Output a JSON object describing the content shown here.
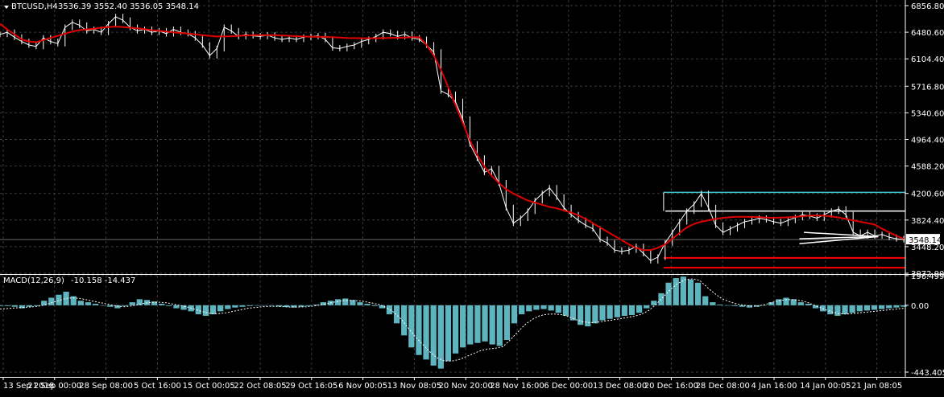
{
  "header": {
    "symbol": "BTCUSD,H4",
    "ohlc": "3536.39 3552.40 3536.05 3548.14"
  },
  "macd": {
    "label": "MACD(12,26,9)",
    "values": "-10.158 -14.437",
    "y_ticks": [
      "196.499",
      "0.00",
      "-443.405"
    ]
  },
  "colors": {
    "background": "#000000",
    "grid": "#3a3a3a",
    "price": "#ffffff",
    "ma": "#e00000",
    "macd_hist": "#5fb5bf",
    "signal": "#ffffff",
    "cyan_level": "#3fc3cf",
    "white_level": "#ffffff",
    "red_level": "#ff0000"
  },
  "chart_data": [
    {
      "type": "line",
      "ylim": [
        3072,
        6856.8
      ],
      "y_ticks": [
        6856.8,
        6480.6,
        6104.4,
        5716.8,
        5340.6,
        4964.4,
        4588.2,
        4200.6,
        3824.4,
        3448.2,
        3072.0
      ],
      "y_tick_labels": [
        "6856.80",
        "6480.60",
        "6104.40",
        "5716.80",
        "5340.60",
        "4964.40",
        "4588.20",
        "4200.60",
        "3824.40",
        "3448.20",
        "3072.00"
      ],
      "x_labels": [
        "13 Sep 2018",
        "21 Sep 00:00",
        "28 Sep 08:00",
        "5 Oct 16:00",
        "15 Oct 00:05",
        "22 Oct 08:05",
        "29 Oct 16:05",
        "6 Nov 00:05",
        "13 Nov 08:05",
        "20 Nov 20:00",
        "28 Nov 16:00",
        "6 Dec 00:00",
        "13 Dec 08:00",
        "20 Dec 16:00",
        "28 Dec 08:00",
        "4 Jan 16:00",
        "14 Jan 00:05",
        "21 Jan 08:05"
      ],
      "current_price": 3548.14,
      "current_price_label": "3548.14",
      "series": [
        {
          "role": "price",
          "values": [
            6450,
            6480,
            6410,
            6350,
            6300,
            6280,
            6400,
            6350,
            6320,
            6550,
            6620,
            6580,
            6500,
            6520,
            6480,
            6600,
            6700,
            6650,
            6550,
            6500,
            6520,
            6480,
            6500,
            6460,
            6520,
            6480,
            6460,
            6400,
            6300,
            6150,
            6250,
            6550,
            6500,
            6420,
            6450,
            6430,
            6420,
            6440,
            6400,
            6380,
            6400,
            6380,
            6410,
            6420,
            6430,
            6380,
            6260,
            6250,
            6280,
            6300,
            6350,
            6380,
            6420,
            6480,
            6460,
            6420,
            6450,
            6400,
            6380,
            6300,
            6200,
            5650,
            5600,
            5500,
            5250,
            4900,
            4700,
            4500,
            4550,
            4350,
            4000,
            3780,
            3850,
            3950,
            4100,
            4200,
            4280,
            4150,
            4000,
            3900,
            3820,
            3750,
            3700,
            3550,
            3500,
            3400,
            3380,
            3400,
            3450,
            3350,
            3250,
            3300,
            3500,
            3650,
            3800,
            3950,
            4050,
            4200,
            4000,
            3750,
            3650,
            3700,
            3750,
            3800,
            3820,
            3850,
            3830,
            3800,
            3780,
            3820,
            3860,
            3900,
            3880,
            3850,
            3900,
            3950,
            3980,
            3900,
            3650,
            3600,
            3650,
            3600,
            3620,
            3580,
            3560,
            3548
          ]
        },
        {
          "role": "moving-average",
          "values": [
            6600,
            6520,
            6450,
            6380,
            6350,
            6340,
            6370,
            6400,
            6430,
            6460,
            6490,
            6510,
            6520,
            6530,
            6545,
            6555,
            6560,
            6555,
            6545,
            6535,
            6525,
            6510,
            6500,
            6490,
            6480,
            6470,
            6460,
            6450,
            6440,
            6430,
            6420,
            6420,
            6425,
            6430,
            6435,
            6438,
            6440,
            6440,
            6438,
            6435,
            6430,
            6425,
            6420,
            6418,
            6416,
            6414,
            6410,
            6405,
            6400,
            6398,
            6396,
            6395,
            6396,
            6398,
            6400,
            6402,
            6405,
            6410,
            6410,
            6300,
            6150,
            5950,
            5700,
            5450,
            5200,
            4950,
            4750,
            4580,
            4450,
            4350,
            4260,
            4200,
            4150,
            4100,
            4070,
            4040,
            4010,
            3990,
            3960,
            3930,
            3890,
            3840,
            3780,
            3720,
            3660,
            3600,
            3540,
            3480,
            3430,
            3400,
            3400,
            3430,
            3480,
            3560,
            3640,
            3720,
            3770,
            3800,
            3820,
            3840,
            3855,
            3865,
            3870,
            3870,
            3868,
            3866,
            3860,
            3855,
            3858,
            3862,
            3870,
            3878,
            3886,
            3890,
            3885,
            3876,
            3860,
            3840,
            3820,
            3800,
            3780,
            3760,
            3700,
            3650,
            3600,
            3560
          ]
        }
      ],
      "horizontal_levels": [
        {
          "value": 4216,
          "from": 0.733,
          "color": "cyan"
        },
        {
          "value": 3952,
          "from": 0.735,
          "color": "white"
        },
        {
          "value": 3290,
          "from": 0.733,
          "color": "red"
        },
        {
          "value": 3150,
          "from": 0.733,
          "color": "red"
        }
      ],
      "triangle": [
        {
          "from": [
            0.883,
            3560
          ],
          "to": [
            0.97,
            3590
          ]
        },
        {
          "from": [
            0.883,
            3490
          ],
          "to": [
            0.97,
            3590
          ]
        },
        {
          "from": [
            0.888,
            3650
          ],
          "to": [
            0.97,
            3590
          ]
        }
      ]
    },
    {
      "type": "bar",
      "ylim": [
        -443.405,
        196.499
      ],
      "series": [
        {
          "role": "histogram",
          "values": [
            -5,
            -5,
            -10,
            -20,
            -10,
            -5,
            30,
            50,
            70,
            90,
            60,
            30,
            20,
            10,
            0,
            -10,
            -20,
            -5,
            20,
            40,
            35,
            25,
            10,
            -5,
            -20,
            -30,
            -40,
            -60,
            -70,
            -60,
            -40,
            -25,
            -15,
            -10,
            -5,
            -2,
            0,
            -3,
            -8,
            -12,
            -15,
            -10,
            -5,
            5,
            20,
            30,
            40,
            45,
            35,
            20,
            10,
            -5,
            -20,
            -60,
            -120,
            -200,
            -280,
            -330,
            -360,
            -400,
            -420,
            -370,
            -320,
            -280,
            -260,
            -250,
            -240,
            -260,
            -270,
            -230,
            -120,
            -60,
            -40,
            -30,
            -25,
            -35,
            -50,
            -70,
            -100,
            -130,
            -140,
            -120,
            -100,
            -90,
            -80,
            -70,
            -65,
            -50,
            -20,
            30,
            80,
            150,
            180,
            190,
            170,
            150,
            60,
            20,
            5,
            0,
            -5,
            -10,
            -15,
            -10,
            0,
            20,
            40,
            50,
            40,
            20,
            10,
            -20,
            -40,
            -60,
            -70,
            -60,
            -50,
            -40,
            -35,
            -30,
            -25,
            -20,
            -15,
            -10
          ]
        },
        {
          "role": "signal",
          "values": [
            -25,
            -22,
            -18,
            -15,
            -12,
            -8,
            0,
            15,
            30,
            45,
            50,
            45,
            35,
            25,
            15,
            5,
            -5,
            -10,
            -5,
            5,
            15,
            20,
            20,
            15,
            5,
            -5,
            -15,
            -30,
            -45,
            -55,
            -55,
            -50,
            -40,
            -30,
            -20,
            -15,
            -10,
            -8,
            -8,
            -10,
            -12,
            -12,
            -10,
            -5,
            3,
            12,
            22,
            30,
            33,
            30,
            25,
            15,
            5,
            -15,
            -45,
            -90,
            -150,
            -210,
            -260,
            -310,
            -350,
            -370,
            -370,
            -360,
            -340,
            -320,
            -300,
            -290,
            -285,
            -275,
            -230,
            -180,
            -130,
            -95,
            -70,
            -60,
            -58,
            -62,
            -75,
            -95,
            -110,
            -115,
            -112,
            -105,
            -98,
            -90,
            -82,
            -73,
            -60,
            -35,
            5,
            55,
            105,
            145,
            170,
            175,
            165,
            120,
            80,
            45,
            25,
            10,
            0,
            -5,
            -5,
            5,
            20,
            32,
            38,
            36,
            30,
            15,
            -5,
            -25,
            -42,
            -55,
            -58,
            -55,
            -50,
            -45,
            -40,
            -35,
            -30,
            -25,
            -20
          ]
        }
      ]
    }
  ]
}
